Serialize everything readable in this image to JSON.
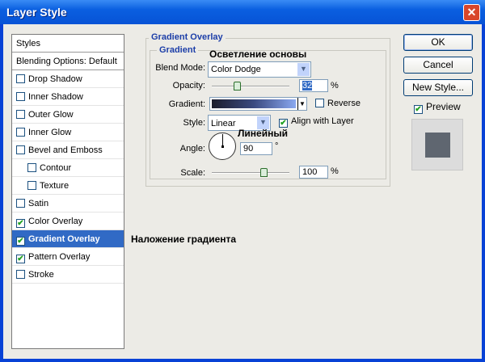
{
  "window": {
    "title": "Layer Style"
  },
  "sidebar": {
    "items": [
      {
        "label": "Styles",
        "checkbox": false,
        "checked": false,
        "indent": 0
      },
      {
        "label": "Blending Options: Default",
        "checkbox": false,
        "checked": false,
        "indent": 0
      },
      {
        "label": "Drop Shadow",
        "checkbox": true,
        "checked": false,
        "indent": 0
      },
      {
        "label": "Inner Shadow",
        "checkbox": true,
        "checked": false,
        "indent": 0
      },
      {
        "label": "Outer Glow",
        "checkbox": true,
        "checked": false,
        "indent": 0
      },
      {
        "label": "Inner Glow",
        "checkbox": true,
        "checked": false,
        "indent": 0
      },
      {
        "label": "Bevel and Emboss",
        "checkbox": true,
        "checked": false,
        "indent": 0
      },
      {
        "label": "Contour",
        "checkbox": true,
        "checked": false,
        "indent": 1
      },
      {
        "label": "Texture",
        "checkbox": true,
        "checked": false,
        "indent": 1
      },
      {
        "label": "Satin",
        "checkbox": true,
        "checked": false,
        "indent": 0
      },
      {
        "label": "Color Overlay",
        "checkbox": true,
        "checked": true,
        "indent": 0
      },
      {
        "label": "Gradient Overlay",
        "checkbox": true,
        "checked": true,
        "indent": 0,
        "selected": true
      },
      {
        "label": "Pattern Overlay",
        "checkbox": true,
        "checked": true,
        "indent": 0
      },
      {
        "label": "Stroke",
        "checkbox": true,
        "checked": false,
        "indent": 0
      }
    ]
  },
  "panel": {
    "title": "Gradient Overlay",
    "group": "Gradient",
    "blend_mode_label": "Blend Mode:",
    "blend_mode": "Color Dodge",
    "opacity_label": "Opacity:",
    "opacity": "32",
    "opacity_unit": "%",
    "opacity_value": 32,
    "gradient_label": "Gradient:",
    "reverse_label": "Reverse",
    "reverse": false,
    "style_label": "Style:",
    "style": "Linear",
    "align_label": "Align with Layer",
    "align": true,
    "angle_label": "Angle:",
    "angle": "90",
    "angle_unit": "°",
    "scale_label": "Scale:",
    "scale": "100",
    "scale_unit": "%",
    "scale_value": 100
  },
  "annotations": {
    "blend": "Осветление основы",
    "style": "Линейный",
    "gradient_overlay": "Наложение градиента"
  },
  "buttons": {
    "ok": "OK",
    "cancel": "Cancel",
    "new_style": "New Style...",
    "preview": "Preview",
    "preview_checked": true
  }
}
